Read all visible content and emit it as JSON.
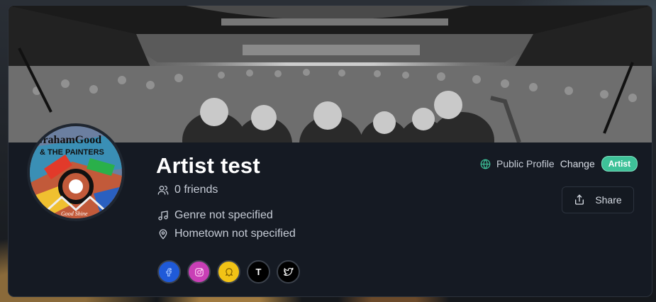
{
  "profile": {
    "name": "Artist test",
    "friends": "0 friends",
    "genre": "Genre not specified",
    "hometown": "Hometown not specified",
    "visibility": "Public Profile",
    "change_label": "Change",
    "badge": "Artist",
    "share_label": "Share"
  },
  "avatar": {
    "logo_line1": "GrahamGood",
    "logo_line2": "& THE PAINTERS",
    "logo_bottom": "Good Shine"
  },
  "socials": {
    "tiktok_glyph": "T"
  },
  "colors": {
    "card_bg": "#151a23",
    "badge_green": "#3ec198",
    "globe_green": "#3ec198",
    "facebook": "#1f5ad8",
    "instagram": "#c93fb6",
    "snapchat": "#f2c316"
  },
  "icons": {
    "friends": "users-icon",
    "genre": "music-note-icon",
    "hometown": "map-pin-icon",
    "visibility": "globe-icon",
    "share": "share-upload-icon"
  }
}
